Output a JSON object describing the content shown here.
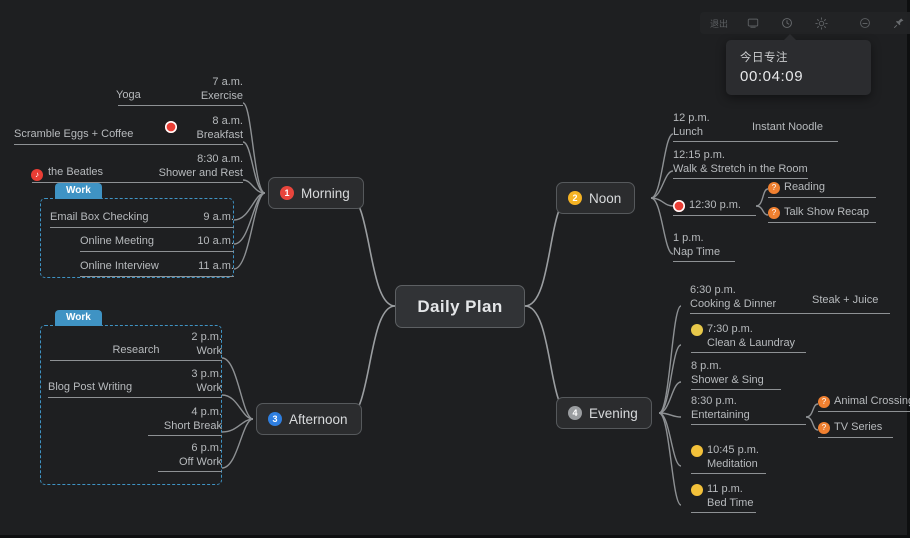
{
  "toolbar": {
    "exit_label": "退出",
    "items": [
      {
        "name": "exit",
        "label": "退出"
      },
      {
        "name": "presentation-icon",
        "label": ""
      },
      {
        "name": "clock-icon",
        "label": ""
      },
      {
        "name": "brightness-icon",
        "label": ""
      },
      {
        "name": "mood-icon",
        "label": ""
      },
      {
        "name": "pin-icon",
        "label": ""
      }
    ]
  },
  "timer": {
    "label": "今日专注",
    "value": "00:04:09"
  },
  "root": {
    "title": "Daily Plan"
  },
  "colors": {
    "badge_morning": "#e8453c",
    "badge_noon": "#f5b324",
    "badge_afternoon": "#2f7fe0",
    "badge_evening": "#9a9da0",
    "group_blue": "#3f93c4",
    "link": "#9b9ea1",
    "canvas": "#1e1f21"
  },
  "branches": [
    {
      "id": "morning",
      "num": "1",
      "label": "Morning"
    },
    {
      "id": "noon",
      "num": "2",
      "label": "Noon"
    },
    {
      "id": "afternoon",
      "num": "3",
      "label": "Afternoon"
    },
    {
      "id": "evening",
      "num": "4",
      "label": "Evening"
    }
  ],
  "morning": {
    "items": [
      {
        "time": "7 a.m.",
        "task": "Exercise",
        "side_label": "Yoga"
      },
      {
        "time": "8 a.m.",
        "task": "Breakfast",
        "side_label": "Scramble Eggs + Coffee",
        "icon": "red-dot-icon"
      },
      {
        "time": "8:30 a.m.",
        "task": "Shower and Rest",
        "side_label": "the Beatles",
        "side_icon": "music-note-icon"
      }
    ],
    "group": {
      "tag": "Work",
      "rows": [
        {
          "task": "Email Box Checking",
          "time": "9 a.m."
        },
        {
          "task": "Online Meeting",
          "time": "10 a.m."
        },
        {
          "task": "Online Interview",
          "time": "11 a.m."
        }
      ]
    }
  },
  "afternoon": {
    "group": {
      "tag": "Work",
      "rows": [
        {
          "time": "2 p.m.",
          "task": "Work",
          "side_label": "Research"
        },
        {
          "time": "3 p.m.",
          "task": "Work",
          "side_label": "Blog Post Writing"
        },
        {
          "time": "4 p.m.",
          "task": "Short Break",
          "side_label": ""
        },
        {
          "time": "6 p.m.",
          "task": "Off Work",
          "side_label": ""
        }
      ]
    }
  },
  "noon": {
    "items": [
      {
        "time": "12 p.m.",
        "task": "Lunch",
        "detail": "Instant Noodle"
      },
      {
        "time": "12:15 p.m.",
        "task": "Walk & Stretch in the Room",
        "detail": ""
      },
      {
        "time": "12:30 p.m.",
        "task": "",
        "icon": "red-dot-icon",
        "children": [
          {
            "label": "Reading",
            "icon": "orange-question-icon"
          },
          {
            "label": "Talk Show Recap",
            "icon": "orange-question-icon"
          }
        ]
      },
      {
        "time": "1 p.m.",
        "task": "Nap Time",
        "detail": ""
      }
    ]
  },
  "evening": {
    "items": [
      {
        "time": "6:30 p.m.",
        "task": "Cooking & Dinner",
        "detail": "Steak + Juice"
      },
      {
        "time": "7:30 p.m.",
        "task": "Clean & Laundray",
        "icon": "teal-emoji-icon"
      },
      {
        "time": "8 p.m.",
        "task": "Shower & Sing"
      },
      {
        "time": "8:30 p.m.",
        "task": "Entertaining",
        "children": [
          {
            "label": "Animal Crossing",
            "icon": "orange-question-icon"
          },
          {
            "label": "TV Series",
            "icon": "orange-question-icon"
          }
        ]
      },
      {
        "time": "10:45 p.m.",
        "task": "Meditation",
        "icon": "yellow-emoji-icon"
      },
      {
        "time": "11 p.m.",
        "task": "Bed Time",
        "icon": "yellow-emoji-icon"
      }
    ]
  }
}
